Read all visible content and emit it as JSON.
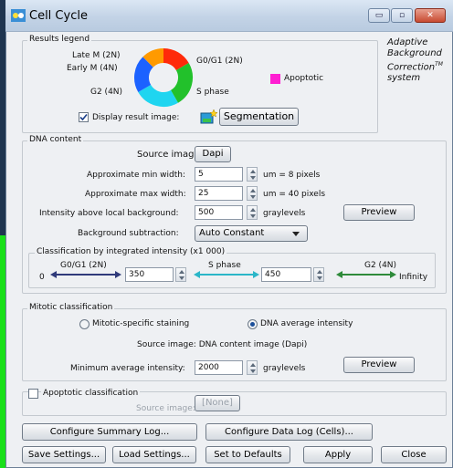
{
  "window": {
    "title": "Cell Cycle",
    "controls": {
      "minimize": "▭",
      "maximize": "▫",
      "close": "✕"
    }
  },
  "results_legend": {
    "title": "Results legend",
    "labels": {
      "late_m": "Late M (2N)",
      "early_m": "Early M (4N)",
      "g0g1": "G0/G1 (2N)",
      "g2": "G2 (4N)",
      "s_phase": "S phase",
      "apoptotic": "Apoptotic"
    },
    "colors": {
      "late_m": "#ff2a0a",
      "early_m": "#ff9a00",
      "g0g1": "#22c12b",
      "g2": "#1c62ff",
      "s_phase": "#1fd5f0",
      "apoptotic": "#ff1fd2"
    },
    "display_result_image": {
      "label": "Display result image:",
      "checked": true
    },
    "segmentation_button": "Segmentation",
    "brand": {
      "line1": "Adaptive",
      "line2": "Background",
      "line3": "Correction",
      "tm": "TM",
      "line4": "system"
    }
  },
  "dna_content": {
    "title": "DNA content",
    "source_image_label": "Source image:",
    "source_image_value": "Dapi",
    "min_width_label": "Approximate min width:",
    "min_width_value": "5",
    "min_width_unit": "um = 8 pixels",
    "max_width_label": "Approximate max width:",
    "max_width_value": "25",
    "max_width_unit": "um = 40 pixels",
    "intensity_label": "Intensity above local background:",
    "intensity_value": "500",
    "intensity_unit": "graylevels",
    "preview_button": "Preview",
    "bg_subtraction_label": "Background subtraction:",
    "bg_subtraction_value": "Auto Constant",
    "classification": {
      "title": "Classification by integrated intensity (x1 000)",
      "start": "0",
      "end": "Infinity",
      "g0g1_label": "G0/G1 (2N)",
      "s_label": "S phase",
      "g2_label": "G2 (4N)",
      "threshold1": "350",
      "threshold2": "450"
    }
  },
  "mitotic": {
    "title": "Mitotic classification",
    "option1": "Mitotic-specific staining",
    "option2": "DNA average intensity",
    "selected": "option2",
    "source_text": "Source image: DNA content image (Dapi)",
    "min_avg_label": "Minimum average intensity:",
    "min_avg_value": "2000",
    "min_avg_unit": "graylevels",
    "preview_button": "Preview"
  },
  "apoptotic": {
    "title": "Apoptotic classification",
    "checked": false,
    "source_image_label": "Source image:",
    "source_image_value": "[None]"
  },
  "buttons": {
    "configure_summary_log": "Configure Summary Log...",
    "configure_data_log": "Configure Data Log (Cells)...",
    "save_settings": "Save Settings...",
    "load_settings": "Load Settings...",
    "set_to_defaults": "Set to Defaults",
    "apply": "Apply",
    "close": "Close"
  }
}
